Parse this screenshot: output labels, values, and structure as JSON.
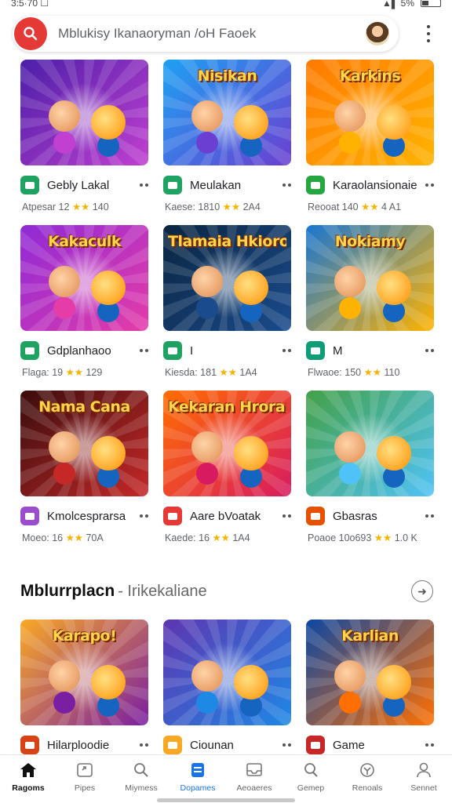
{
  "status": {
    "time": "3:5·70 ☐",
    "signal": "▲▌ 5%"
  },
  "search": {
    "placeholder": "Mblukisy Ikanaoryman /oH Faoek"
  },
  "apps": [
    {
      "name": "Gebly Lakal",
      "meta_left": "Atpesar 12",
      "meta_right": "140",
      "icon_color": "#1ea362",
      "title": "",
      "bg1": "#4b1fa8",
      "bg2": "#c13fd1"
    },
    {
      "name": "Meulakan",
      "meta_left": "Kaese: 1810",
      "meta_right": "2A4",
      "icon_color": "#1ea362",
      "title": "Nisikan",
      "bg1": "#1da1f2",
      "bg2": "#6b3fd1"
    },
    {
      "name": "Karaolansionaie",
      "meta_left": "Reooat 140",
      "meta_right": "4 A1",
      "icon_color": "#26a641",
      "title": "Karkins",
      "bg1": "#ff7a00",
      "bg2": "#ffb300"
    },
    {
      "name": "Gdplanhaoo",
      "meta_left": "Flaga: 19",
      "meta_right": "129",
      "icon_color": "#1ea362",
      "title": "Kakaculk",
      "bg1": "#8e2ad6",
      "bg2": "#e53ca8"
    },
    {
      "name": "I",
      "meta_left": "Kiesda: 181",
      "meta_right": "1A4",
      "icon_color": "#1ea362",
      "title": "Tlamaia Hkiorosok",
      "bg1": "#0a2540",
      "bg2": "#1a4b8c"
    },
    {
      "name": "M",
      "meta_left": "Flwaoe: 150",
      "meta_right": "110",
      "icon_color": "#0f9d77",
      "title": "Nokiamy",
      "bg1": "#1976d2",
      "bg2": "#ffb300"
    },
    {
      "name": "Kmolcesprarsa",
      "meta_left": "Moeo: 16",
      "meta_right": "70A",
      "icon_color": "#9c4dcc",
      "title": "Nama Cana",
      "bg1": "#3a0d0d",
      "bg2": "#c62828"
    },
    {
      "name": "Aare bVoatak",
      "meta_left": "Kaede: 16",
      "meta_right": "1A4",
      "icon_color": "#e53935",
      "title": "Kekaran Hrorarluo",
      "bg1": "#ff6d00",
      "bg2": "#d81b60"
    },
    {
      "name": "Gbasras",
      "meta_left": "Poaoe 10o693",
      "meta_right": "1.0 K",
      "icon_color": "#e65100",
      "title": "",
      "bg1": "#43a047",
      "bg2": "#4fc3f7"
    }
  ],
  "section": {
    "title": "Mblurrplacn",
    "subtitle": "- Irikekaliane"
  },
  "apps2": [
    {
      "name": "Hilarploodie",
      "icon_color": "#d84315",
      "title": "Karapo!",
      "bg1": "#f9a825",
      "bg2": "#7b1fa2"
    },
    {
      "name": "Ciounan",
      "icon_color": "#f9a825",
      "title": "",
      "bg1": "#5e35b1",
      "bg2": "#1e88e5"
    },
    {
      "name": "Game",
      "icon_color": "#c62828",
      "title": "Karlian",
      "bg1": "#0d47a1",
      "bg2": "#ff6f00"
    }
  ],
  "nav": [
    {
      "label": "Ragoms",
      "icon": "home-icon"
    },
    {
      "label": "Pipes",
      "icon": "apps-icon"
    },
    {
      "label": "Miymess",
      "icon": "search-icon"
    },
    {
      "label": "Dopames",
      "icon": "library-icon"
    },
    {
      "label": "Aeoaeres",
      "icon": "inbox-icon"
    },
    {
      "label": "Gemep",
      "icon": "person-search-icon"
    },
    {
      "label": "Renoals",
      "icon": "share-icon"
    },
    {
      "label": "Sennet",
      "icon": "account-icon"
    }
  ]
}
